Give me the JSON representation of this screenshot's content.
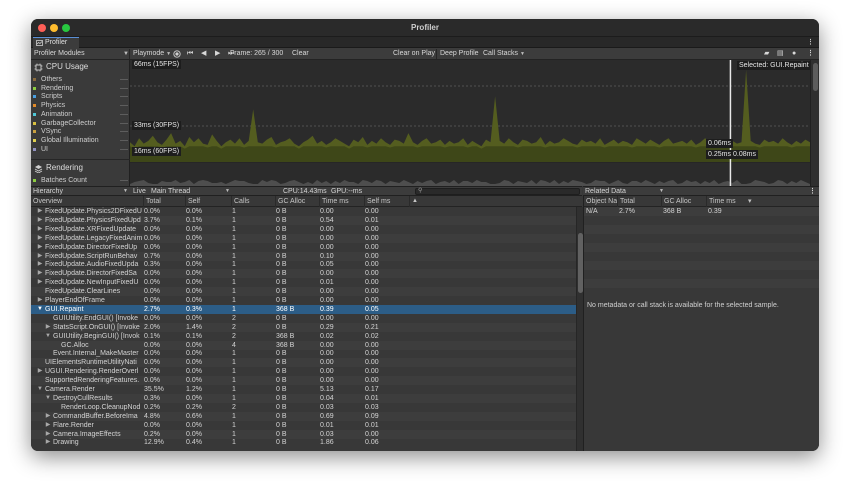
{
  "window": {
    "title": "Profiler"
  },
  "tab": {
    "label": "Profiler"
  },
  "toolbar": {
    "modules_label": "Profiler Modules",
    "playmode_label": "Playmode",
    "frame_label": "Frame: 265 / 300",
    "clear_label": "Clear",
    "clear_on_play_label": "Clear on Play",
    "deep_profile_label": "Deep Profile",
    "call_stacks_label": "Call Stacks"
  },
  "modules": {
    "cpu": {
      "title": "CPU Usage",
      "legend": [
        {
          "label": "Others",
          "color": "#8a6b3c"
        },
        {
          "label": "Rendering",
          "color": "#8ccc40"
        },
        {
          "label": "Scripts",
          "color": "#4aa0e0"
        },
        {
          "label": "Physics",
          "color": "#e08a2a"
        },
        {
          "label": "Animation",
          "color": "#50c8d8"
        },
        {
          "label": "GarbageCollector",
          "color": "#d8c040"
        },
        {
          "label": "VSync",
          "color": "#c8a040"
        },
        {
          "label": "Global Illumination",
          "color": "#e0d050"
        },
        {
          "label": "UI",
          "color": "#9090c0"
        }
      ]
    },
    "rendering": {
      "title": "Rendering",
      "legend": [
        {
          "label": "Batches Count",
          "color": "#8ccc40"
        }
      ]
    }
  },
  "graph": {
    "line_66": "66ms (15FPS)",
    "line_33": "33ms (30FPS)",
    "line_16": "16ms (60FPS)",
    "selected": "Selected: GUI.Repaint",
    "tip_1": "0.06ms",
    "tip_2": "0.25ms",
    "tip_3": "0.08ms",
    "selected_frame_fraction": 0.883,
    "cpu_series": [
      15,
      12,
      18,
      14,
      16,
      20,
      15,
      13,
      17,
      22,
      14,
      16,
      12,
      19,
      15,
      18,
      14,
      13,
      21,
      16,
      12,
      15,
      17,
      14,
      18,
      13,
      16,
      40,
      15,
      14,
      17,
      19,
      13,
      15,
      16,
      18,
      14,
      12,
      15,
      17,
      20,
      14,
      16,
      13,
      15,
      18,
      16,
      14,
      12,
      17,
      15,
      19,
      13,
      16,
      14,
      18,
      15,
      13,
      17,
      16,
      14,
      22,
      15,
      13,
      16,
      18,
      14,
      15,
      17,
      13,
      16,
      14,
      15,
      18,
      13,
      16,
      14,
      12,
      17,
      15,
      50,
      16,
      14,
      18,
      15,
      13,
      17,
      16,
      14,
      15,
      19,
      13,
      16,
      14,
      15,
      18,
      16,
      14,
      13,
      17,
      15,
      16,
      14,
      18,
      13,
      15,
      17,
      14,
      16,
      15,
      13,
      18,
      16,
      14,
      17,
      15,
      13,
      16,
      18,
      14,
      15,
      16,
      14,
      17,
      13,
      15,
      18,
      16,
      14,
      15,
      17,
      13,
      16,
      14,
      15,
      70,
      16,
      14,
      13,
      17,
      15,
      16,
      14,
      18,
      15,
      13,
      16,
      14,
      17,
      15
    ]
  },
  "hierarchy": {
    "view_label": "Hierarchy",
    "live_label": "Live",
    "thread_label": "Main Thread",
    "cpu_label": "CPU:14.43ms",
    "gpu_label": "GPU:--ms",
    "columns": [
      "Overview",
      "Total",
      "Self",
      "Calls",
      "GC Alloc",
      "Time ms",
      "Self ms"
    ],
    "rows": [
      {
        "depth": 1,
        "exp": true,
        "name": "FixedUpdate.Physics2DFixedU",
        "total": "0.0%",
        "self": "0.0%",
        "calls": "1",
        "gc": "0 B",
        "time": "0.00",
        "selfms": "0.00"
      },
      {
        "depth": 1,
        "exp": true,
        "name": "FixedUpdate.PhysicsFixedUpd",
        "total": "3.7%",
        "self": "0.1%",
        "calls": "1",
        "gc": "0 B",
        "time": "0.54",
        "selfms": "0.01"
      },
      {
        "depth": 1,
        "exp": true,
        "name": "FixedUpdate.XRFixedUpdate",
        "total": "0.0%",
        "self": "0.0%",
        "calls": "1",
        "gc": "0 B",
        "time": "0.00",
        "selfms": "0.00"
      },
      {
        "depth": 1,
        "exp": true,
        "name": "FixedUpdate.LegacyFixedAnim",
        "total": "0.0%",
        "self": "0.0%",
        "calls": "1",
        "gc": "0 B",
        "time": "0.00",
        "selfms": "0.00"
      },
      {
        "depth": 1,
        "exp": true,
        "name": "FixedUpdate.DirectorFixedUp",
        "total": "0.0%",
        "self": "0.0%",
        "calls": "1",
        "gc": "0 B",
        "time": "0.00",
        "selfms": "0.00"
      },
      {
        "depth": 1,
        "exp": true,
        "name": "FixedUpdate.ScriptRunBehav",
        "total": "0.7%",
        "self": "0.0%",
        "calls": "1",
        "gc": "0 B",
        "time": "0.10",
        "selfms": "0.00"
      },
      {
        "depth": 1,
        "exp": true,
        "name": "FixedUpdate.AudioFixedUpda",
        "total": "0.3%",
        "self": "0.0%",
        "calls": "1",
        "gc": "0 B",
        "time": "0.05",
        "selfms": "0.00"
      },
      {
        "depth": 1,
        "exp": true,
        "name": "FixedUpdate.DirectorFixedSa",
        "total": "0.0%",
        "self": "0.0%",
        "calls": "1",
        "gc": "0 B",
        "time": "0.00",
        "selfms": "0.00"
      },
      {
        "depth": 1,
        "exp": true,
        "name": "FixedUpdate.NewInputFixedU",
        "total": "0.0%",
        "self": "0.0%",
        "calls": "1",
        "gc": "0 B",
        "time": "0.01",
        "selfms": "0.00"
      },
      {
        "depth": 1,
        "exp": false,
        "name": "FixedUpdate.ClearLines",
        "total": "0.0%",
        "self": "0.0%",
        "calls": "1",
        "gc": "0 B",
        "time": "0.00",
        "selfms": "0.00"
      },
      {
        "depth": 1,
        "exp": true,
        "name": "PlayerEndOfFrame",
        "total": "0.0%",
        "self": "0.0%",
        "calls": "1",
        "gc": "0 B",
        "time": "0.00",
        "selfms": "0.00"
      },
      {
        "depth": 1,
        "exp": true,
        "open": true,
        "sel": true,
        "name": "GUI.Repaint",
        "total": "2.7%",
        "self": "0.3%",
        "calls": "1",
        "gc": "368 B",
        "time": "0.39",
        "selfms": "0.05"
      },
      {
        "depth": 2,
        "exp": false,
        "name": "GUIUtility.EndGUI() [Invoke",
        "total": "0.0%",
        "self": "0.0%",
        "calls": "2",
        "gc": "0 B",
        "time": "0.00",
        "selfms": "0.00"
      },
      {
        "depth": 2,
        "exp": true,
        "name": "StatsScript.OnGUI() [Invoke",
        "total": "2.0%",
        "self": "1.4%",
        "calls": "2",
        "gc": "0 B",
        "time": "0.29",
        "selfms": "0.21"
      },
      {
        "depth": 2,
        "exp": true,
        "open": true,
        "name": "GUIUtility.BeginGUI() [Invok",
        "total": "0.1%",
        "self": "0.1%",
        "calls": "2",
        "gc": "368 B",
        "time": "0.02",
        "selfms": "0.02"
      },
      {
        "depth": 3,
        "exp": false,
        "name": "GC.Alloc",
        "total": "0.0%",
        "self": "0.0%",
        "calls": "4",
        "gc": "368 B",
        "time": "0.00",
        "selfms": "0.00"
      },
      {
        "depth": 2,
        "exp": false,
        "name": "Event.Internal_MakeMaster",
        "total": "0.0%",
        "self": "0.0%",
        "calls": "1",
        "gc": "0 B",
        "time": "0.00",
        "selfms": "0.00"
      },
      {
        "depth": 1,
        "exp": false,
        "name": "UIElementsRuntimeUtilityNati",
        "total": "0.0%",
        "self": "0.0%",
        "calls": "1",
        "gc": "0 B",
        "time": "0.00",
        "selfms": "0.00"
      },
      {
        "depth": 1,
        "exp": true,
        "name": "UGUI.Rendering.RenderOverl",
        "total": "0.0%",
        "self": "0.0%",
        "calls": "1",
        "gc": "0 B",
        "time": "0.00",
        "selfms": "0.00"
      },
      {
        "depth": 1,
        "exp": false,
        "name": "SupportedRenderingFeatures.",
        "total": "0.0%",
        "self": "0.0%",
        "calls": "1",
        "gc": "0 B",
        "time": "0.00",
        "selfms": "0.00"
      },
      {
        "depth": 1,
        "exp": true,
        "open": true,
        "name": "Camera.Render",
        "total": "35.5%",
        "self": "1.2%",
        "calls": "1",
        "gc": "0 B",
        "time": "5.13",
        "selfms": "0.17"
      },
      {
        "depth": 2,
        "exp": true,
        "open": true,
        "name": "DestroyCullResults",
        "total": "0.3%",
        "self": "0.0%",
        "calls": "1",
        "gc": "0 B",
        "time": "0.04",
        "selfms": "0.01"
      },
      {
        "depth": 3,
        "exp": false,
        "name": "RenderLoop.CleanupNod",
        "total": "0.2%",
        "self": "0.2%",
        "calls": "2",
        "gc": "0 B",
        "time": "0.03",
        "selfms": "0.03"
      },
      {
        "depth": 2,
        "exp": true,
        "name": "CommandBuffer.BeforeIma",
        "total": "4.8%",
        "self": "0.6%",
        "calls": "1",
        "gc": "0 B",
        "time": "0.69",
        "selfms": "0.09"
      },
      {
        "depth": 2,
        "exp": true,
        "name": "Flare.Render",
        "total": "0.0%",
        "self": "0.0%",
        "calls": "1",
        "gc": "0 B",
        "time": "0.01",
        "selfms": "0.01"
      },
      {
        "depth": 2,
        "exp": true,
        "name": "Camera.ImageEffects",
        "total": "0.2%",
        "self": "0.0%",
        "calls": "1",
        "gc": "0 B",
        "time": "0.03",
        "selfms": "0.00"
      },
      {
        "depth": 2,
        "exp": true,
        "name": "Drawing",
        "total": "12.9%",
        "self": "0.4%",
        "calls": "1",
        "gc": "0 B",
        "time": "1.86",
        "selfms": "0.06"
      }
    ]
  },
  "related": {
    "title": "Related Data",
    "columns": [
      "Object Na",
      "Total",
      "GC Alloc",
      "Time ms"
    ],
    "row": {
      "name": "N/A",
      "total": "2.7%",
      "gc": "368 B",
      "time": "0.39"
    },
    "message": "No metadata or call stack is available for the selected sample."
  }
}
